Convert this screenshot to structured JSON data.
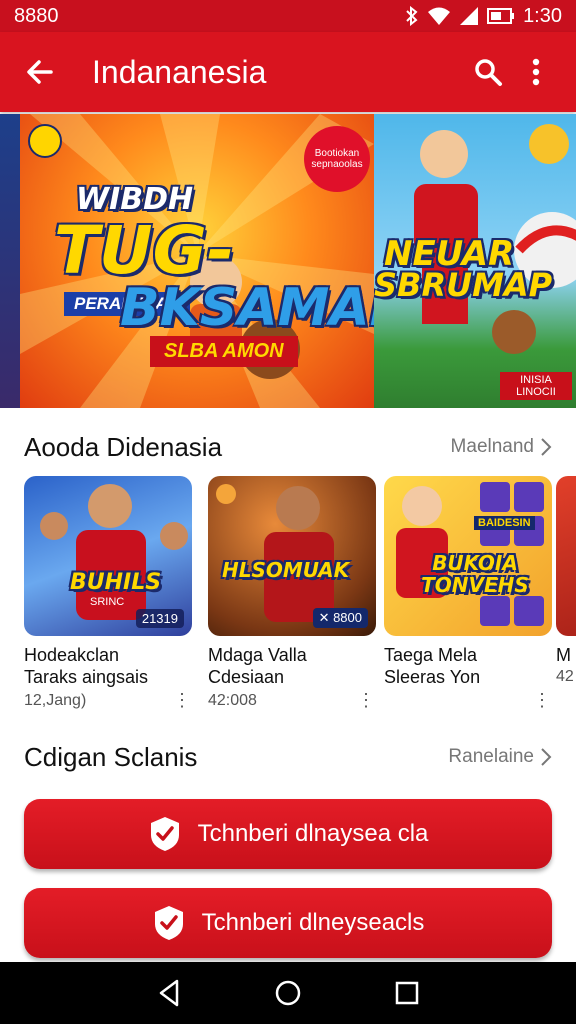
{
  "statusbar": {
    "time_left": "8880",
    "time_right": "1:30"
  },
  "appbar": {
    "title": "Indananesia",
    "icons": [
      "back-arrow-icon",
      "search-icon",
      "more-vert-icon"
    ]
  },
  "banner": {
    "main": {
      "line1": "WIBDH",
      "line2": "TUG-",
      "line3": "PERAIAHIAR",
      "line4": "BKSAMAN",
      "line5": "SLBA AMON",
      "bubble": "Bootiokan sepnaoolas"
    },
    "side": {
      "line1": "NEUAR",
      "line2": "SBRUMAP",
      "tag": "INISIA LINOCII"
    }
  },
  "section1": {
    "title": "Aooda Didenasia",
    "more": "Maelnand"
  },
  "cards": [
    {
      "thumb_title": "BUHILS",
      "thumb_sub": "SRINC",
      "badge": "21319",
      "line1": "Hodeakclan",
      "line2": "Taraks aingsais",
      "meta": "12,Jang)"
    },
    {
      "thumb_title": "HLSOMUAK",
      "badge": "✕ 8800",
      "line1": "Mdaga Valla",
      "line2": "Cdesiaan",
      "meta": "42:008"
    },
    {
      "thumb_title": "BUKOIA TONVEHS",
      "thumb_sub": "BAIDESIN",
      "line1": "Taega Mela",
      "line2": "Sleeras Yon",
      "meta": ""
    },
    {
      "line1": "M",
      "line2": "",
      "meta": "42"
    }
  ],
  "section2": {
    "title": "Cdigan Sclanis",
    "more": "Ranelaine"
  },
  "buttons": [
    {
      "label": "Tchnberi dlnaysea cla"
    },
    {
      "label": "Tchnberi dlneyseacls"
    }
  ],
  "colors": {
    "brand_red": "#d9141f",
    "nav_black": "#000000"
  }
}
